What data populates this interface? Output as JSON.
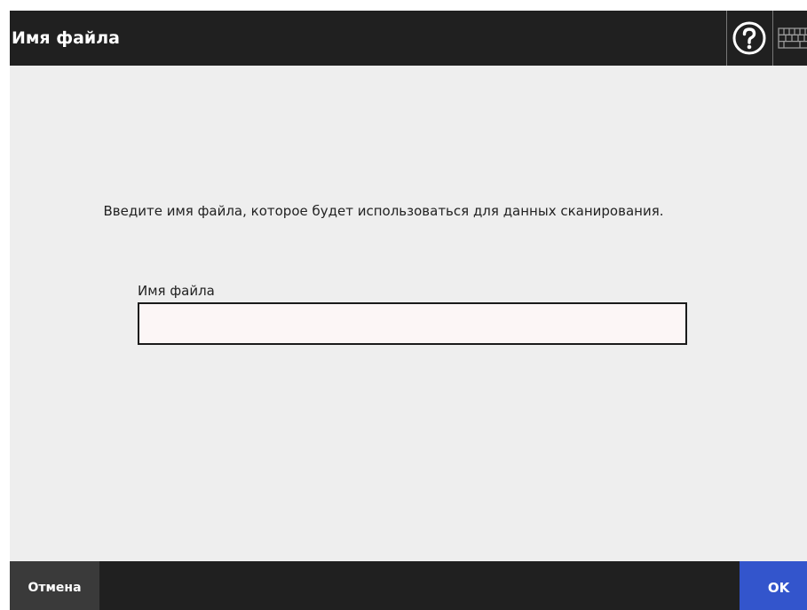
{
  "header": {
    "title": "Имя файла",
    "help_icon": "question-circle-icon",
    "keyboard_icon": "keyboard-icon"
  },
  "main": {
    "instruction": "Введите имя файла, которое будет использоваться для данных сканирования.",
    "field_label": "Имя файла",
    "field_value": ""
  },
  "footer": {
    "cancel_label": "Отмена",
    "ok_label": "OK"
  },
  "colors": {
    "header_background": "#202020",
    "content_background": "#eeeeee",
    "ok_button": "#3355cc",
    "cancel_button": "#3a3a3a",
    "input_background": "#fcf6f6"
  }
}
